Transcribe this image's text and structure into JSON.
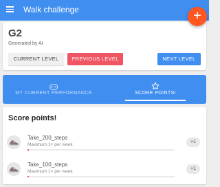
{
  "appbar": {
    "title": "Walk challenge",
    "menu_icon": "menu-icon"
  },
  "fab": {
    "label": "+"
  },
  "level": {
    "name": "G2",
    "subtitle": "Generated by AI",
    "buttons": {
      "current": "CURRENT LEVEL",
      "previous": "PREVIOUS LEVEL",
      "next": "NEXT LEVEL"
    }
  },
  "tabs": [
    {
      "label": "MY CURRENT PERFORMANCE",
      "icon": "gamepad-icon",
      "active": false
    },
    {
      "label": "SCORE POINTS!",
      "icon": "star-icon",
      "active": true
    }
  ],
  "score": {
    "title": "Score points!",
    "items": [
      {
        "name": "Take_200_steps",
        "limit": "Maximum 1× per week",
        "points": "+1",
        "progress": 0.01
      },
      {
        "name": "Take_100_steps",
        "limit": "Maximum 1× per week",
        "points": "+1",
        "progress": 0.01
      }
    ]
  },
  "colors": {
    "primary": "#3f8ef0",
    "accent": "#ff5722",
    "danger": "#ef5562"
  }
}
